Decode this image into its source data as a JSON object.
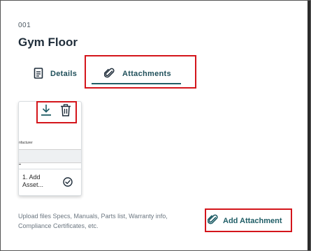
{
  "header": {
    "code": "001",
    "title": "Gym Floor"
  },
  "tabs": [
    {
      "label": "Details",
      "icon": "document-icon"
    },
    {
      "label": "Attachments",
      "icon": "paperclip-icon",
      "active": true
    }
  ],
  "attachment_card": {
    "name": "1. Add Asset...",
    "thumbnail_text": "nfacturer",
    "actions": [
      "download-icon",
      "delete-icon"
    ],
    "status_icon": "check-circle-icon"
  },
  "footer": {
    "hint": "Upload files Specs, Manuals, Parts list, Warranty info, Compliance Certificates, etc.",
    "add_button": "Add Attachment"
  },
  "colors": {
    "accent": "#1f5d66",
    "highlight": "#d4151b",
    "title": "#1f2d3a"
  }
}
